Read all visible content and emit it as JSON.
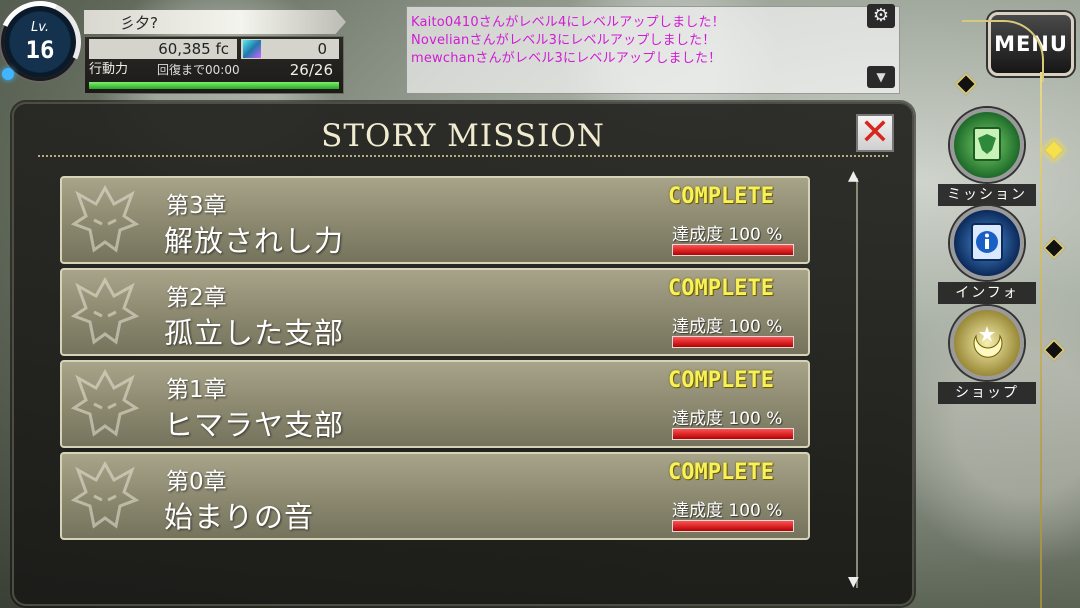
{
  "player": {
    "level_label": "Lv.",
    "level": "16",
    "name": "彡夕?",
    "money": "60,385 fc",
    "crystals": "0",
    "ap_label": "行動力",
    "recovery": "回復まで00:00",
    "ap": "26/26",
    "ap_fraction": 1.0
  },
  "chat": {
    "lines": [
      "Kaito0410さんがレベル4にレベルアップしました！",
      "Novelianさんがレベル3にレベルアップしました！",
      "mewchanさんがレベル3にレベルアップしました！"
    ],
    "settings_icon": "gear-icon",
    "expand_icon": "chevron-down-icon",
    "color": "#d11bd6"
  },
  "menu": {
    "label": "MENU",
    "items": [
      {
        "label": "ミッション",
        "icon": "mission-icon",
        "highlighted": true
      },
      {
        "label": "インフォ",
        "icon": "info-icon",
        "highlighted": false
      },
      {
        "label": "ショップ",
        "icon": "shop-icon",
        "highlighted": false
      }
    ]
  },
  "panel": {
    "title": "STORY MISSION",
    "close_icon": "close-icon",
    "missions": [
      {
        "chapter": "第3章",
        "title": "解放されし力",
        "status": "COMPLETE",
        "achievement": "達成度 100 %",
        "progress": 1.0
      },
      {
        "chapter": "第2章",
        "title": "孤立した支部",
        "status": "COMPLETE",
        "achievement": "達成度 100 %",
        "progress": 1.0
      },
      {
        "chapter": "第1章",
        "title": "ヒマラヤ支部",
        "status": "COMPLETE",
        "achievement": "達成度 100 %",
        "progress": 1.0
      },
      {
        "chapter": "第0章",
        "title": "始まりの音",
        "status": "COMPLETE",
        "achievement": "達成度 100 %",
        "progress": 1.0
      }
    ]
  },
  "colors": {
    "accent_gold": "#f8f25a",
    "progress_red": "#d10000",
    "ap_green": "#2aa628"
  }
}
